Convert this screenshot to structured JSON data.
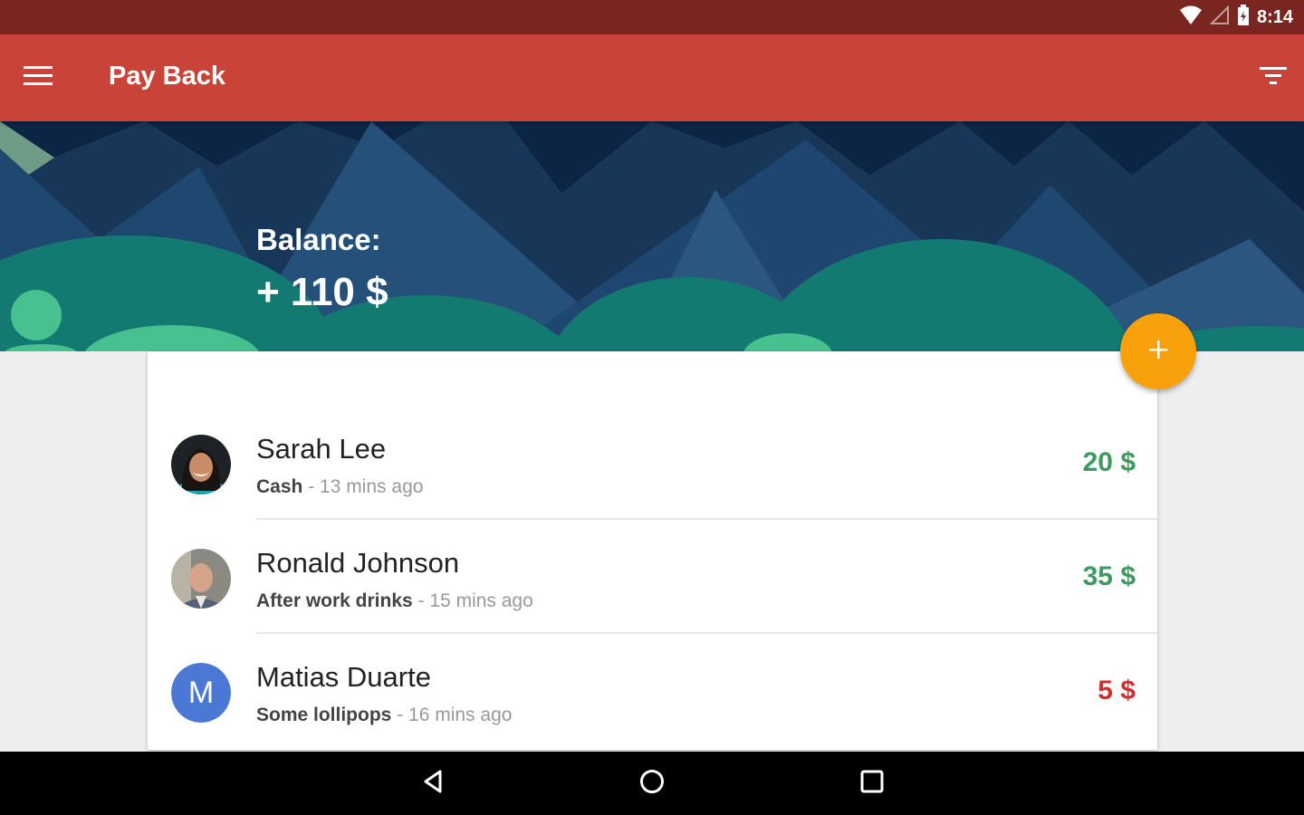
{
  "status_bar": {
    "time": "8:14",
    "icons": [
      "wifi-icon",
      "cell-signal-icon",
      "battery-icon"
    ]
  },
  "app_bar": {
    "title": "Pay Back",
    "menu_icon": "menu-icon",
    "filter_icon": "filter-icon"
  },
  "balance": {
    "label": "Balance:",
    "value": "+ 110 $"
  },
  "transactions": [
    {
      "name": "Sarah Lee",
      "description": "Cash",
      "time": "13 mins ago",
      "amount": "20 $",
      "status": "positive",
      "avatar": "photo"
    },
    {
      "name": "Ronald Johnson",
      "description": "After work drinks",
      "time": "15 mins ago",
      "amount": "35 $",
      "status": "positive",
      "avatar": "photo"
    },
    {
      "name": "Matias Duarte",
      "description": "Some lollipops",
      "time": "16 mins ago",
      "amount": "5 $",
      "status": "negative",
      "avatar": "letter",
      "avatar_letter": "M"
    }
  ],
  "fab": {
    "icon": "plus-icon"
  },
  "nav_bar": {
    "icons": [
      "back-icon",
      "home-icon",
      "recents-icon"
    ]
  },
  "colors": {
    "primary": "#ca4338",
    "primary_dark": "#7a2620",
    "accent": "#f9a10a",
    "positive": "#3f9a5f",
    "negative": "#d12f2f"
  }
}
